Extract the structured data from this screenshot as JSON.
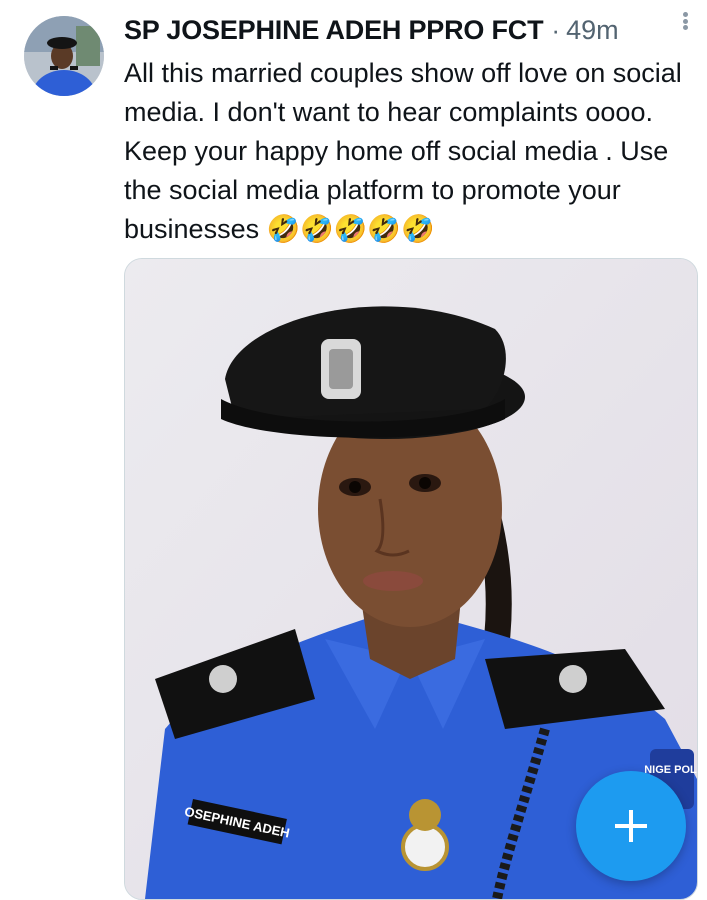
{
  "tweet": {
    "author_name": "SP JOSEPHINE ADEH PPRO FCT",
    "separator": "·",
    "time": "49m",
    "text": "All this married couples show off love on social media. I don't want to hear complaints oooo. Keep your happy home off social media . Use the social media platform to promote your businesses 🤣🤣🤣🤣🤣",
    "image": {
      "name_tag": "OSEPHINE ADEH",
      "shoulder_badge": "NIGE POLI"
    }
  },
  "fab": {
    "icon": "plus-icon"
  },
  "colors": {
    "accent": "#1d9bf0",
    "text": "#0f1419",
    "muted": "#536471",
    "uniform": "#2e5fd6",
    "cap": "#141414"
  }
}
